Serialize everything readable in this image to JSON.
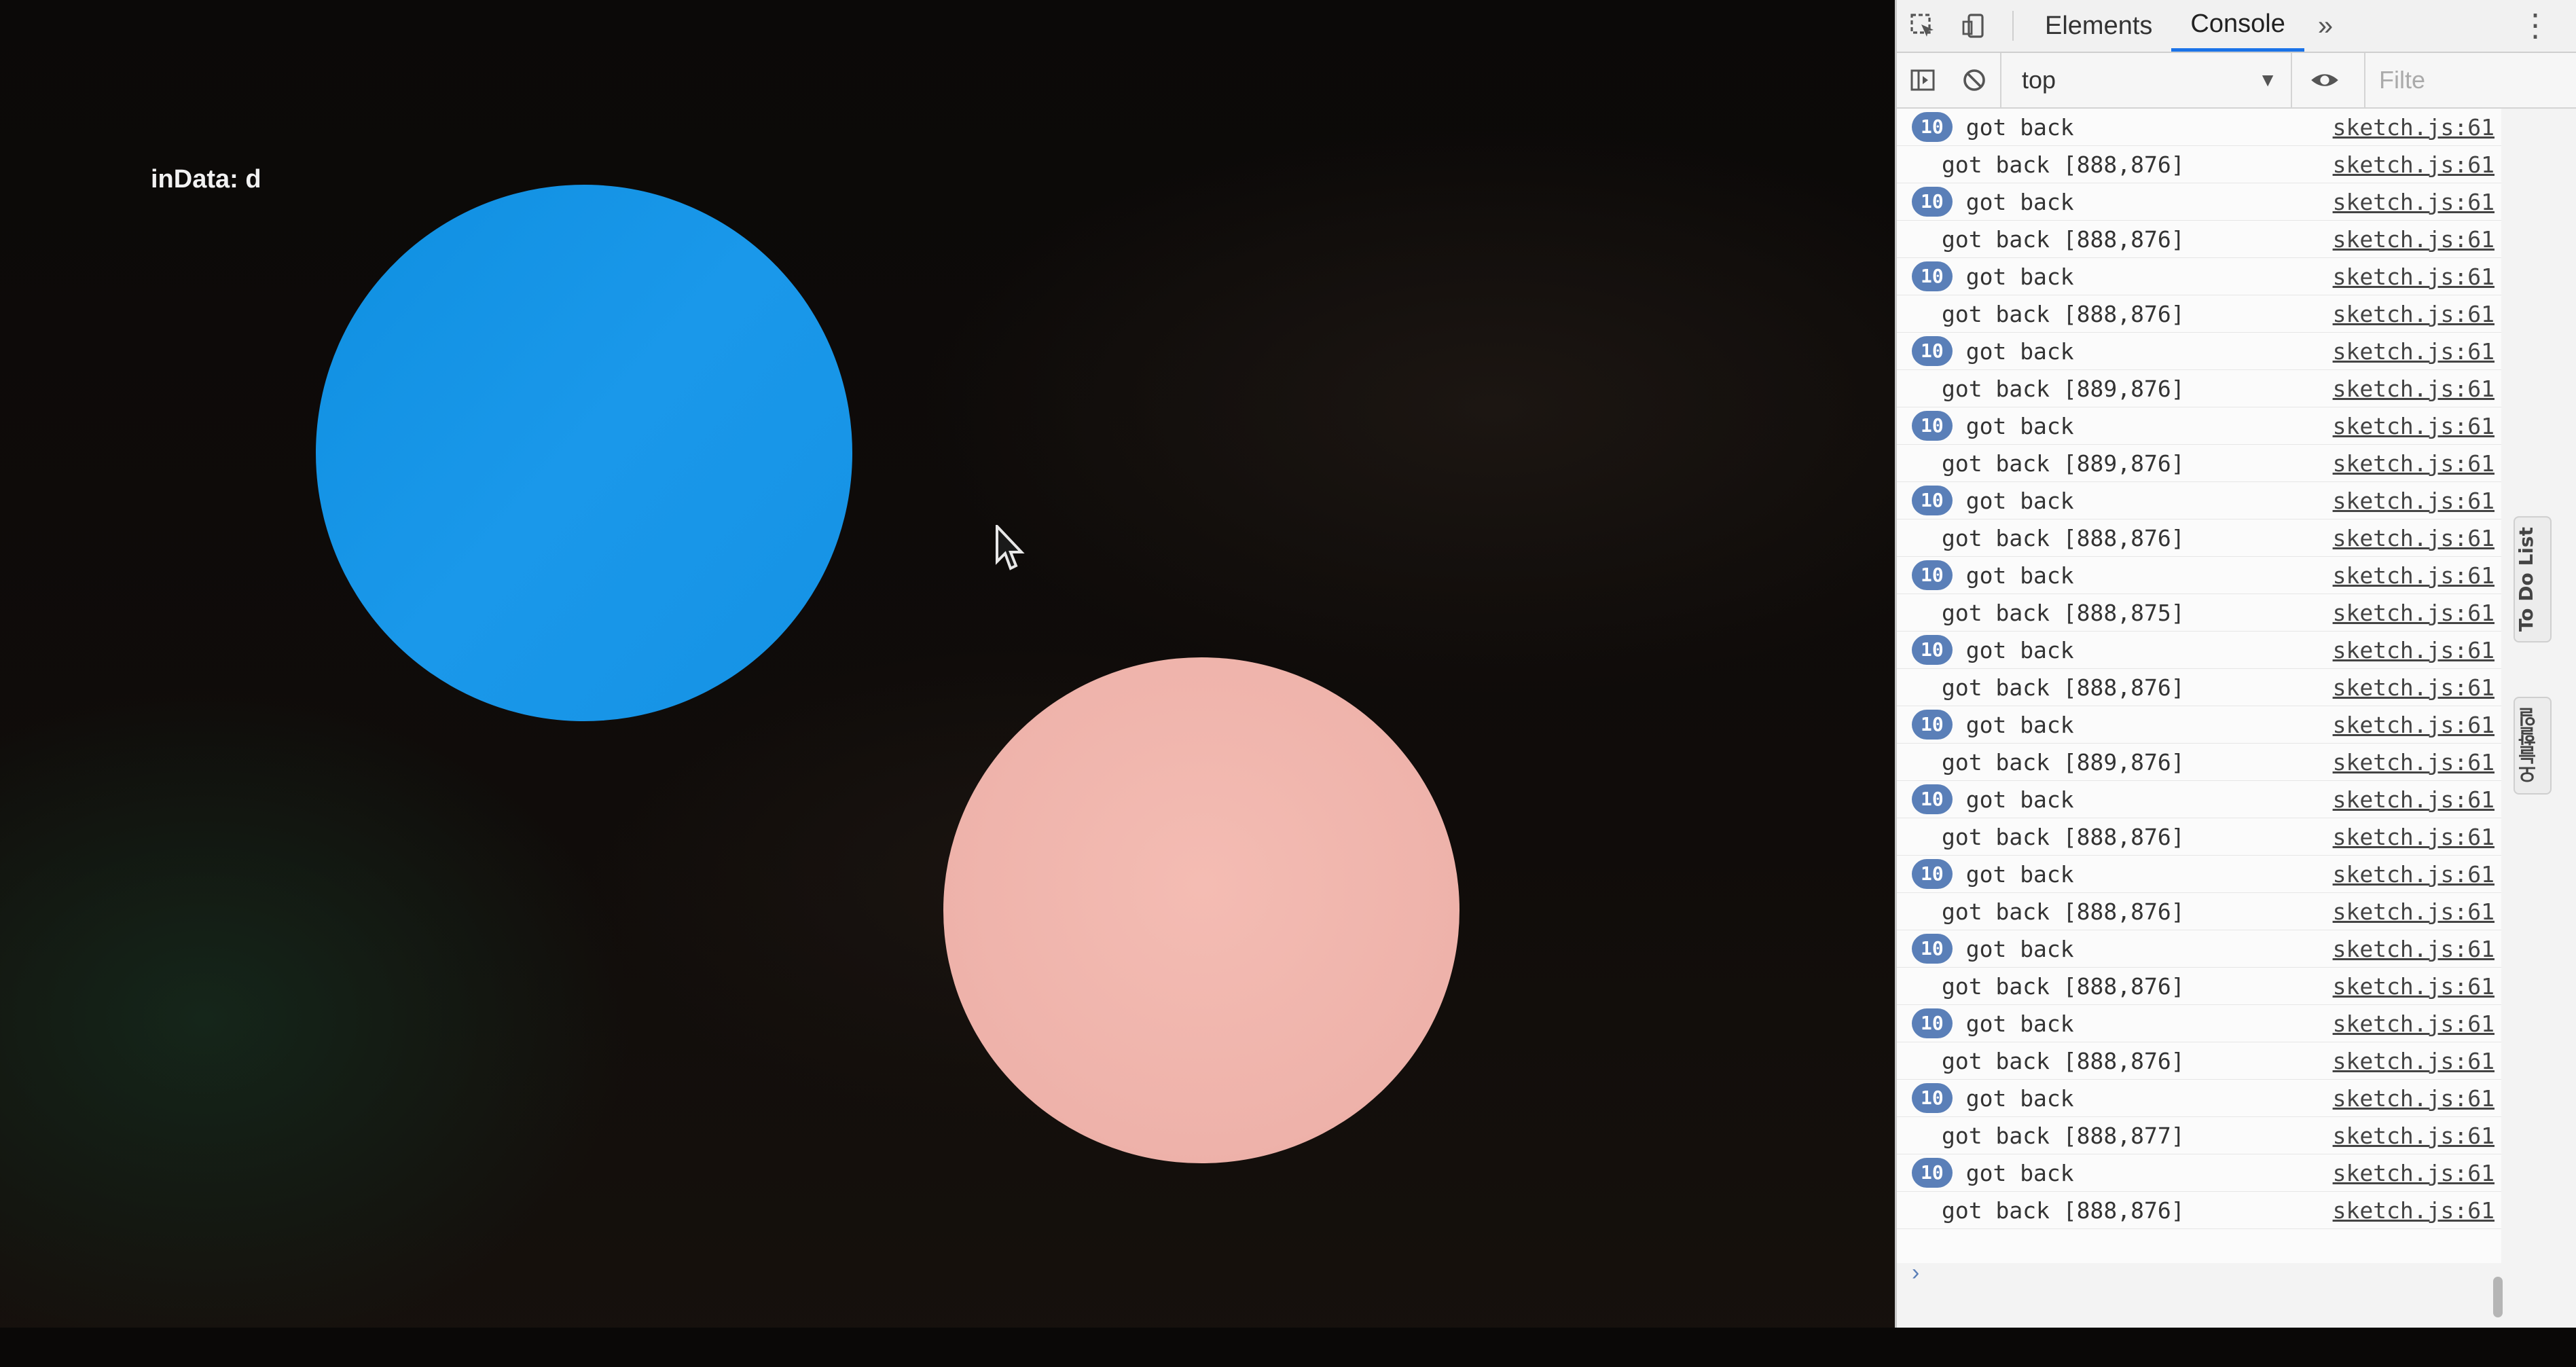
{
  "sketch": {
    "indata_label": "inData:",
    "indata_value": "d",
    "colors": {
      "blue_circle": "#1592e4",
      "pink_circle": "#eeb2aa"
    }
  },
  "devtools": {
    "tabs": [
      "Elements",
      "Console"
    ],
    "active_tab": "Console",
    "more_tabs_glyph": "»",
    "context_selector": "top",
    "filter_placeholder": "Filte",
    "side_tabs": [
      "To Do List",
      "오늘할일"
    ],
    "badge_color": "#5a7fb8",
    "console": {
      "rows": [
        {
          "badge": "10",
          "text": "got back",
          "source": "sketch.js:61"
        },
        {
          "badge": "",
          "text": "got back [888,876]",
          "source": "sketch.js:61"
        },
        {
          "badge": "10",
          "text": "got back",
          "source": "sketch.js:61"
        },
        {
          "badge": "",
          "text": "got back [888,876]",
          "source": "sketch.js:61"
        },
        {
          "badge": "10",
          "text": "got back",
          "source": "sketch.js:61"
        },
        {
          "badge": "",
          "text": "got back [888,876]",
          "source": "sketch.js:61"
        },
        {
          "badge": "10",
          "text": "got back",
          "source": "sketch.js:61"
        },
        {
          "badge": "",
          "text": "got back [889,876]",
          "source": "sketch.js:61"
        },
        {
          "badge": "10",
          "text": "got back",
          "source": "sketch.js:61"
        },
        {
          "badge": "",
          "text": "got back [889,876]",
          "source": "sketch.js:61"
        },
        {
          "badge": "10",
          "text": "got back",
          "source": "sketch.js:61"
        },
        {
          "badge": "",
          "text": "got back [888,876]",
          "source": "sketch.js:61"
        },
        {
          "badge": "10",
          "text": "got back",
          "source": "sketch.js:61"
        },
        {
          "badge": "",
          "text": "got back [888,875]",
          "source": "sketch.js:61"
        },
        {
          "badge": "10",
          "text": "got back",
          "source": "sketch.js:61"
        },
        {
          "badge": "",
          "text": "got back [888,876]",
          "source": "sketch.js:61"
        },
        {
          "badge": "10",
          "text": "got back",
          "source": "sketch.js:61"
        },
        {
          "badge": "",
          "text": "got back [889,876]",
          "source": "sketch.js:61"
        },
        {
          "badge": "10",
          "text": "got back",
          "source": "sketch.js:61"
        },
        {
          "badge": "",
          "text": "got back [888,876]",
          "source": "sketch.js:61"
        },
        {
          "badge": "10",
          "text": "got back",
          "source": "sketch.js:61"
        },
        {
          "badge": "",
          "text": "got back [888,876]",
          "source": "sketch.js:61"
        },
        {
          "badge": "10",
          "text": "got back",
          "source": "sketch.js:61"
        },
        {
          "badge": "",
          "text": "got back [888,876]",
          "source": "sketch.js:61"
        },
        {
          "badge": "10",
          "text": "got back",
          "source": "sketch.js:61"
        },
        {
          "badge": "",
          "text": "got back [888,876]",
          "source": "sketch.js:61"
        },
        {
          "badge": "10",
          "text": "got back",
          "source": "sketch.js:61"
        },
        {
          "badge": "",
          "text": "got back [888,877]",
          "source": "sketch.js:61"
        },
        {
          "badge": "10",
          "text": "got back",
          "source": "sketch.js:61"
        },
        {
          "badge": "",
          "text": "got back [888,876]",
          "source": "sketch.js:61"
        }
      ],
      "prompt_glyph": "›"
    }
  }
}
